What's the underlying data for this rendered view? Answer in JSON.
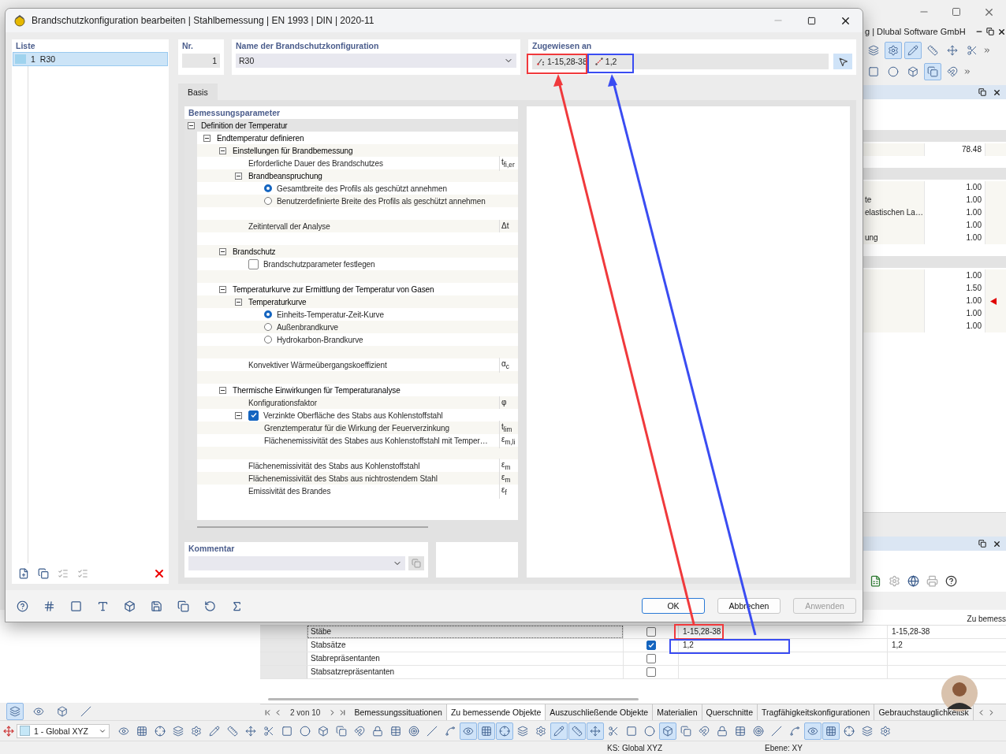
{
  "background": {
    "window_title": "g | Dlubal Software GmbH",
    "toolbar_rows": [
      [
        {
          "on": false
        },
        {
          "on": true
        },
        {
          "on": true
        },
        {
          "on": false
        },
        {
          "on": false
        },
        {
          "on": false
        }
      ],
      [
        {
          "on": false
        },
        {
          "on": false
        },
        {
          "on": false
        },
        {
          "on": true
        },
        {
          "on": false
        }
      ]
    ],
    "results_panel": {
      "sections": [
        {
          "rows": [
            {
              "value": "78.48",
              "flagged": false
            }
          ]
        },
        {
          "rows": [
            {
              "value": "1.00",
              "flagged": false
            },
            {
              "label": "te",
              "value": "1.00",
              "flagged": false
            },
            {
              "label": "elastischen La…",
              "value": "1.00",
              "flagged": false
            },
            {
              "value": "1.00",
              "flagged": false
            },
            {
              "label": "ung",
              "value": "1.00",
              "flagged": false
            }
          ]
        },
        {
          "rows": [
            {
              "value": "1.00",
              "flagged": false
            },
            {
              "value": "1.50",
              "flagged": false
            },
            {
              "value": "1.00",
              "flagged": true
            },
            {
              "value": "1.00",
              "flagged": false
            },
            {
              "value": "1.00",
              "flagged": false
            }
          ]
        }
      ]
    },
    "table": {
      "header": "Zu bemess",
      "rows": [
        {
          "name": "Stäbe",
          "selected": true,
          "checked": false,
          "objects": "1-15,28-38",
          "to_design": "1-15,28-38"
        },
        {
          "name": "Stabsätze",
          "selected": false,
          "checked": true,
          "objects": "1,2",
          "to_design": "1,2"
        },
        {
          "name": "Stabrepräsentanten",
          "selected": false,
          "checked": false
        },
        {
          "name": "Stabsatzrepräsentanten",
          "selected": false,
          "checked": false
        }
      ]
    },
    "panel_buttons": [
      {
        "on": true
      },
      {
        "on": false
      },
      {
        "on": false
      },
      {
        "on": false
      }
    ],
    "navigator": "2 von 10",
    "tabs": [
      {
        "label": "Bemessungssituationen",
        "selected": false
      },
      {
        "label": "Zu bemessende Objekte",
        "selected": true
      },
      {
        "label": "Auszuschließende Objekte",
        "selected": false
      },
      {
        "label": "Materialien",
        "selected": false
      },
      {
        "label": "Querschnitte",
        "selected": false
      },
      {
        "label": "Tragfähigkeitskonfigurationen",
        "selected": false
      },
      {
        "label": "Gebrauchstauglichkeitsk",
        "selected": false
      }
    ],
    "view": "1 - Global XYZ",
    "bottom_toolbar": [
      {
        "on": false
      },
      {
        "on": false
      },
      {
        "on": false
      },
      {
        "on": false
      },
      {
        "on": false
      },
      {
        "on": false
      },
      {
        "on": false
      },
      {
        "on": false
      },
      {
        "on": false
      },
      {
        "on": false
      },
      {
        "on": false
      },
      {
        "on": false
      },
      {
        "on": false
      },
      {
        "on": false
      },
      {
        "on": false
      },
      {
        "on": false
      },
      {
        "on": false
      },
      {
        "on": false
      },
      {
        "on": false
      },
      {
        "on": true
      },
      {
        "on": true
      },
      {
        "on": true
      },
      {
        "on": false
      },
      {
        "on": false
      },
      {
        "on": true
      },
      {
        "on": true
      },
      {
        "on": true
      },
      {
        "on": false
      },
      {
        "on": false
      },
      {
        "on": false
      },
      {
        "on": true
      },
      {
        "on": false
      },
      {
        "on": false
      },
      {
        "on": false
      },
      {
        "on": false
      },
      {
        "on": false
      },
      {
        "on": false
      },
      {
        "on": false
      },
      {
        "on": true
      },
      {
        "on": true
      },
      {
        "on": false
      },
      {
        "on": false
      },
      {
        "on": false
      }
    ],
    "status_bar": [
      "KS: Global XYZ",
      "Ebene: XY"
    ]
  },
  "dialog": {
    "title": "Brandschutzkonfiguration bearbeiten | Stahlbemessung | EN 1993 | DIN | 2020-11",
    "list": {
      "header": "Liste",
      "items": [
        {
          "number": "1",
          "name": "R30",
          "selected": true
        }
      ]
    },
    "list_buttons": [
      {
        "disabled": false
      },
      {
        "disabled": false
      },
      {
        "disabled": true
      },
      {
        "disabled": true
      }
    ],
    "number": {
      "label": "Nr.",
      "value": "1"
    },
    "name": {
      "label": "Name der Brandschutzkonfiguration",
      "value": "R30"
    },
    "assigned": {
      "label": "Zugewiesen an",
      "items": [
        {
          "kind": "members",
          "text": "1-15,28-38"
        },
        {
          "kind": "member_sets",
          "text": "1,2"
        }
      ]
    },
    "tabs": [
      {
        "label": "Basis",
        "selected": true
      }
    ],
    "parameters": {
      "title": "Bemessungsparameter",
      "tree": [
        {
          "kind": "group",
          "label": "Definition der Temperatur",
          "expanded": true,
          "children": [
            {
              "kind": "group",
              "label": "Endtemperatur definieren",
              "expanded": true,
              "children": [
                {
                  "kind": "group",
                  "label": "Einstellungen für Brandbemessung",
                  "expanded": true,
                  "children": [
                    {
                      "kind": "param",
                      "label": "Erforderliche Dauer des Brandschutzes",
                      "symbol": "t$_{fi,er}$"
                    },
                    {
                      "kind": "group",
                      "label": "Brandbeanspruchung",
                      "expanded": true,
                      "children": [
                        {
                          "kind": "radio",
                          "label": "Gesamtbreite des Profils als geschützt annehmen",
                          "selected": true
                        },
                        {
                          "kind": "radio",
                          "label": "Benutzerdefinierte Breite des Profils als geschützt annehmen",
                          "selected": false
                        }
                      ]
                    },
                    {
                      "kind": "param",
                      "label": "Zeitintervall der Analyse",
                      "symbol": "Δt"
                    }
                  ]
                },
                {
                  "kind": "group",
                  "label": "Brandschutz",
                  "expanded": true,
                  "children": [
                    {
                      "kind": "checkbox",
                      "label": "Brandschutzparameter festlegen",
                      "checked": false
                    }
                  ]
                },
                {
                  "kind": "group",
                  "label": "Temperaturkurve zur Ermittlung der Temperatur von Gasen",
                  "expanded": true,
                  "children": [
                    {
                      "kind": "group",
                      "label": "Temperaturkurve",
                      "expanded": true,
                      "children": [
                        {
                          "kind": "radio",
                          "label": "Einheits-Temperatur-Zeit-Kurve",
                          "selected": true
                        },
                        {
                          "kind": "radio",
                          "label": "Außenbrandkurve",
                          "selected": false
                        },
                        {
                          "kind": "radio",
                          "label": "Hydrokarbon-Brandkurve",
                          "selected": false
                        }
                      ]
                    },
                    {
                      "kind": "param",
                      "label": "Konvektiver Wärmeübergangskoeffizient",
                      "symbol": "α$_{c}$"
                    }
                  ]
                },
                {
                  "kind": "group",
                  "label": "Thermische Einwirkungen für Temperaturanalyse",
                  "expanded": true,
                  "children": [
                    {
                      "kind": "param",
                      "label": "Konfigurationsfaktor",
                      "symbol": "φ"
                    },
                    {
                      "kind": "checkbox",
                      "label": "Verzinkte Oberfläche des Stabs aus Kohlenstoffstahl",
                      "checked": true,
                      "expanded": true,
                      "children": [
                        {
                          "kind": "param",
                          "label": "Grenztemperatur für die Wirkung der Feuerverzinkung",
                          "symbol": "t$_{lim}$"
                        },
                        {
                          "kind": "param",
                          "label": "Flächenemissivität des Stabes aus Kohlenstoffstahl mit Temper…",
                          "symbol": "ε$_{m,li}$"
                        }
                      ]
                    },
                    {
                      "kind": "param",
                      "label": "Flächenemissivität des Stabs aus Kohlenstoffstahl",
                      "symbol": "ε$_{m}$"
                    },
                    {
                      "kind": "param",
                      "label": "Flächenemissivität des Stabs aus nichtrostendem Stahl",
                      "symbol": "ε$_{m}$"
                    },
                    {
                      "kind": "param",
                      "label": "Emissivität des Brandes",
                      "symbol": "ε$_{f}$"
                    }
                  ]
                }
              ]
            }
          ]
        }
      ]
    },
    "comment": {
      "label": "Kommentar"
    },
    "buttons": [
      {
        "label": "OK",
        "kind": "default",
        "disabled": false
      },
      {
        "label": "Abbrechen",
        "kind": "normal",
        "disabled": false
      },
      {
        "label": "Anwenden",
        "kind": "normal",
        "disabled": true
      }
    ]
  },
  "annotations": [
    {
      "color": "#f0393c"
    },
    {
      "color": "#3a4cf2"
    }
  ]
}
